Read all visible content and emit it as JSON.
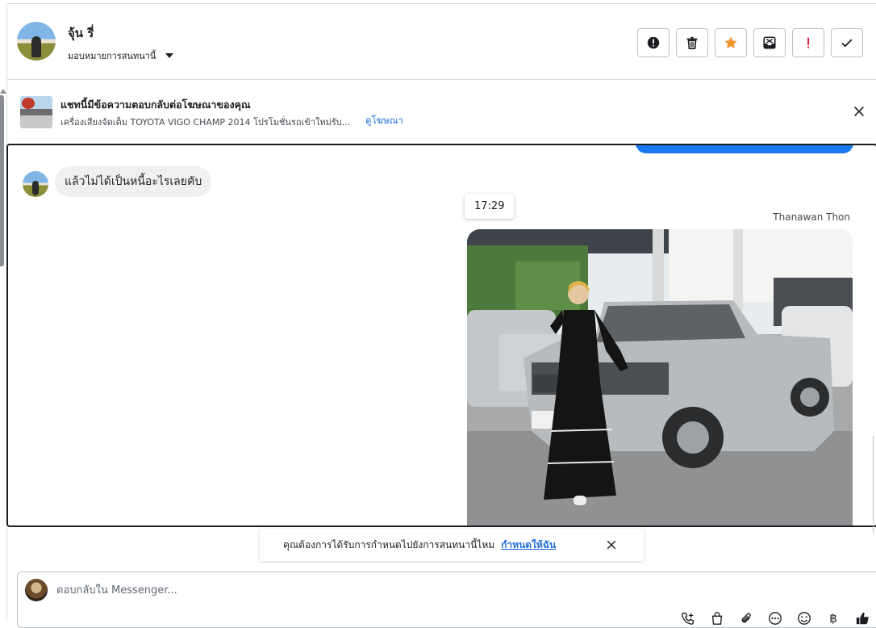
{
  "header": {
    "contact_name": "จุ้น รี่",
    "assign_label": "มอบหมายการสนทนานี้",
    "actions": [
      {
        "name": "report-spam-button",
        "icon": "alert-circle-icon"
      },
      {
        "name": "delete-button",
        "icon": "trash-icon"
      },
      {
        "name": "star-button",
        "icon": "star-icon"
      },
      {
        "name": "move-to-inbox-button",
        "icon": "inbox-icon"
      },
      {
        "name": "mark-important-button",
        "icon": "exclamation-icon"
      },
      {
        "name": "mark-done-button",
        "icon": "check-icon"
      }
    ],
    "accent_star": "#f5922b",
    "accent_important": "#e41e3f"
  },
  "ad_banner": {
    "title": "แชทนี้มีข้อความตอบกลับต่อโฆษณาของคุณ",
    "description": "เครื่องเสียงจัดเต็ม TOYOTA VIGO CHAMP 2014 โปรโมชั่นรถเข้าใหม่รับ...",
    "link": "ดูโฆษณา"
  },
  "messages": {
    "incoming_text": "แล้วไม่ได้เป็นหนี้อะไรเลยคับ",
    "time": "17:29",
    "sender": "Thanawan Thon",
    "outgoing_bubble_color": "#1877f2"
  },
  "prompt": {
    "text": "คุณต้องการได้รับการกำหนดไปยังการสนทนานี้ไหม",
    "link": "กำหนดให้ฉัน"
  },
  "composer": {
    "placeholder": "ตอบกลับใน Messenger...",
    "baht_symbol": "฿",
    "tools": [
      "call-add-icon",
      "shopping-bag-icon",
      "paperclip-icon",
      "more-icon",
      "emoji-icon",
      "baht-icon",
      "thumbs-up-icon"
    ]
  }
}
